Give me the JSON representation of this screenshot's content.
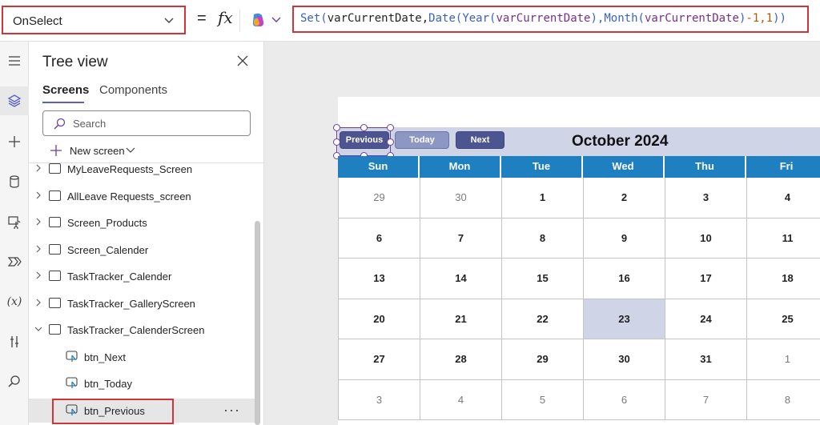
{
  "formula_bar": {
    "property": "OnSelect",
    "equals": "=",
    "fx": "fx",
    "formula_tokens": [
      {
        "t": "Set(",
        "c": "fn"
      },
      {
        "t": "varCurrentDate",
        "c": "dark"
      },
      {
        "t": ",",
        "c": "dark"
      },
      {
        "t": "Date(",
        "c": "fn"
      },
      {
        "t": "Year(",
        "c": "fn"
      },
      {
        "t": "varCurrentDate",
        "c": "var"
      },
      {
        "t": "),",
        "c": "fn"
      },
      {
        "t": "Month(",
        "c": "fn"
      },
      {
        "t": "varCurrentDate",
        "c": "var"
      },
      {
        "t": ")",
        "c": "fn"
      },
      {
        "t": "-1,1",
        "c": "num"
      },
      {
        "t": "))",
        "c": "fn"
      }
    ]
  },
  "rail": {
    "icons": [
      "menu-icon",
      "layers-icon",
      "plus-icon",
      "database-icon",
      "media-icon",
      "power-automate-icon",
      "variables-icon",
      "tools-icon",
      "search-icon"
    ],
    "variables_glyph": "(x)"
  },
  "tree": {
    "title": "Tree view",
    "tabs": [
      "Screens",
      "Components"
    ],
    "search_placeholder": "Search",
    "new_screen": "New screen",
    "nodes": [
      {
        "label": "MyLeaveRequests_Screen",
        "type": "screen",
        "expanded": false
      },
      {
        "label": "AllLeave Requests_screen",
        "type": "screen",
        "expanded": false
      },
      {
        "label": "Screen_Products",
        "type": "screen",
        "expanded": false
      },
      {
        "label": "Screen_Calender",
        "type": "screen",
        "expanded": false
      },
      {
        "label": "TaskTracker_Calender",
        "type": "screen",
        "expanded": false
      },
      {
        "label": "TaskTracker_GalleryScreen",
        "type": "screen",
        "expanded": false
      },
      {
        "label": "TaskTracker_CalenderScreen",
        "type": "screen",
        "expanded": true
      },
      {
        "label": "btn_Next",
        "type": "button",
        "expanded": false
      },
      {
        "label": "btn_Today",
        "type": "button",
        "expanded": false
      },
      {
        "label": "btn_Previous",
        "type": "button",
        "selected": true
      }
    ],
    "more": "···"
  },
  "calendar": {
    "buttons": {
      "previous": "Previous",
      "today": "Today",
      "next": "Next"
    },
    "month_title": "October 2024",
    "day_names": [
      "Sun",
      "Mon",
      "Tue",
      "Wed",
      "Thu",
      "Fri"
    ],
    "weeks": [
      [
        "29",
        "30",
        "1",
        "2",
        "3",
        "4"
      ],
      [
        "6",
        "7",
        "8",
        "9",
        "10",
        "11"
      ],
      [
        "13",
        "14",
        "15",
        "16",
        "17",
        "18"
      ],
      [
        "20",
        "21",
        "22",
        "23",
        "24",
        "25"
      ],
      [
        "27",
        "28",
        "29",
        "30",
        "31",
        "1"
      ],
      [
        "3",
        "4",
        "5",
        "6",
        "7",
        "8"
      ]
    ],
    "muted": [
      [
        0,
        0
      ],
      [
        0,
        1
      ],
      [
        4,
        5
      ],
      [
        5,
        0
      ],
      [
        5,
        1
      ],
      [
        5,
        2
      ],
      [
        5,
        3
      ],
      [
        5,
        4
      ],
      [
        5,
        5
      ]
    ],
    "highlight": [
      3,
      3
    ]
  },
  "colors": {
    "highlight_red": "#d13438",
    "header_blue": "#1e7fc1",
    "button_navy": "#4d5590",
    "accent_purple": "#5b5fc7"
  }
}
